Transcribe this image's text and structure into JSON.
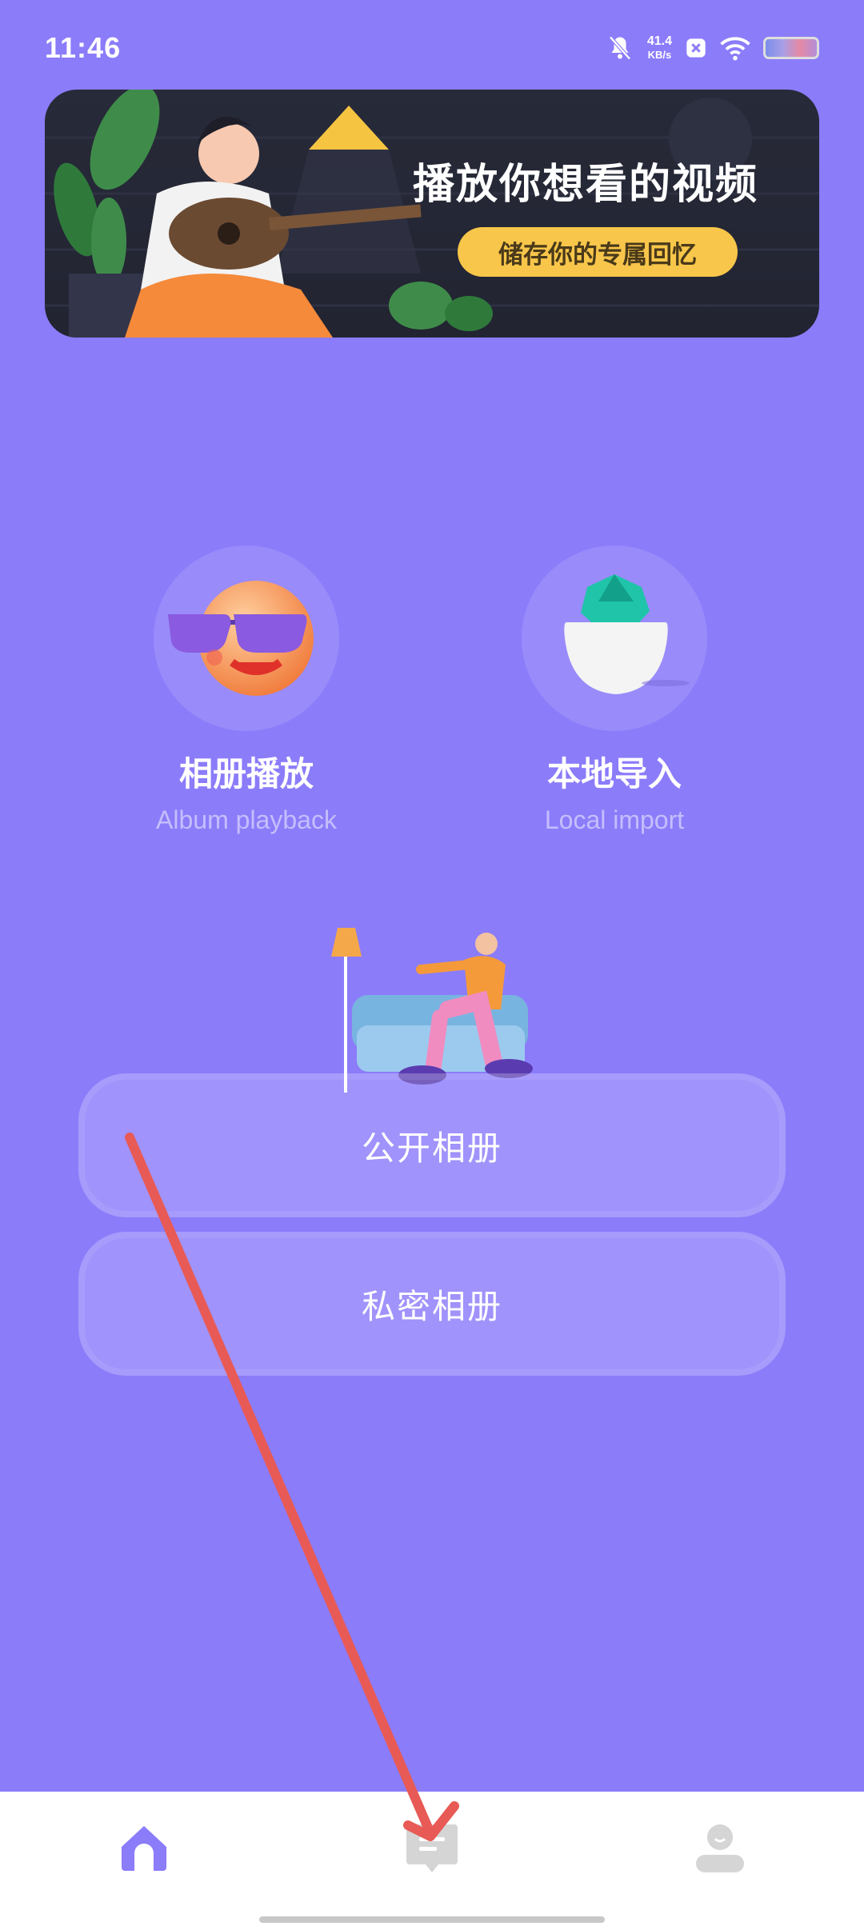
{
  "status_bar": {
    "time": "11:46",
    "net_speed_value": "41.4",
    "net_speed_unit": "KB/s",
    "icons": [
      "mute-bell-icon",
      "close-box-icon",
      "wifi-icon",
      "battery-icon"
    ]
  },
  "banner": {
    "title": "播放你想看的视频",
    "button_label": "储存你的专属回忆"
  },
  "features": [
    {
      "label": "相册播放",
      "sub": "Album playback",
      "icon": "sunglasses-emoji-icon"
    },
    {
      "label": "本地导入",
      "sub": "Local import",
      "icon": "cactus-pot-icon"
    }
  ],
  "albums": {
    "public_label": "公开相册",
    "private_label": "私密相册"
  },
  "bottom_nav": {
    "items": [
      {
        "icon": "home-icon",
        "active": true
      },
      {
        "icon": "message-icon",
        "active": false
      },
      {
        "icon": "profile-icon",
        "active": false
      }
    ]
  },
  "colors": {
    "background": "#8b7cfa",
    "accent": "#8b7cfa",
    "banner_button": "#f8c64a",
    "annotation_arrow": "#e85a55"
  }
}
